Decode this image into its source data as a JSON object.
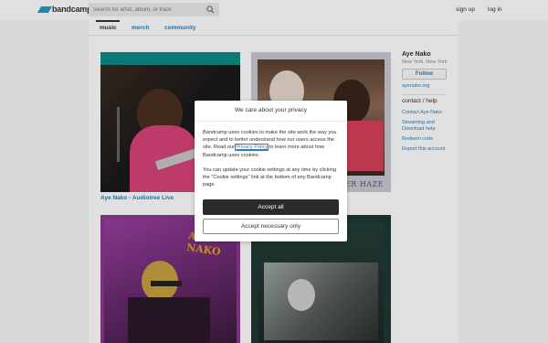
{
  "header": {
    "logo_text": "bandcamp",
    "search_placeholder": "Search for artist, album, or track",
    "signup_label": "sign up",
    "login_label": "log in"
  },
  "tabs": [
    {
      "label": "music"
    },
    {
      "label": "merch"
    },
    {
      "label": "community"
    }
  ],
  "albums": [
    {
      "title": "Aye Nako - Audiotree Live",
      "art_text": "",
      "subtitle": ""
    },
    {
      "title": "",
      "art_text": "SILVER HAZE",
      "subtitle": ""
    },
    {
      "title": "",
      "art_text": "AYE NAKO",
      "subtitle": ""
    },
    {
      "title": "",
      "art_text": "",
      "subtitle": ""
    }
  ],
  "sidebar": {
    "band_name": "Aye Nako",
    "location": "New York, New York",
    "follow_label": "Follow",
    "website": "ayenako.org",
    "contact_heading": "contact / help",
    "links": [
      {
        "label": "Contact Aye Nako"
      },
      {
        "label": "Streaming and Download help"
      },
      {
        "label": "Redeem code"
      },
      {
        "label": "Report this account"
      }
    ]
  },
  "cookie_modal": {
    "title": "We care about your privacy",
    "para1_before": "Bandcamp uses cookies to make the site work the way you expect and to better understand how our users access the site. Read our ",
    "privacy_link": "Privacy Policy",
    "para1_after": " to learn more about how Bandcamp uses cookies.",
    "para2": "You can update your cookie settings at any time by clicking the \"Cookie settings\" link at the bottom of any Bandcamp page.",
    "accept_all": "Accept all",
    "accept_necessary": "Accept necessary only"
  },
  "colors": {
    "accent_link": "#2c7fb8",
    "logo": "#1da0c3",
    "button_dark": "#2b2b2b"
  }
}
